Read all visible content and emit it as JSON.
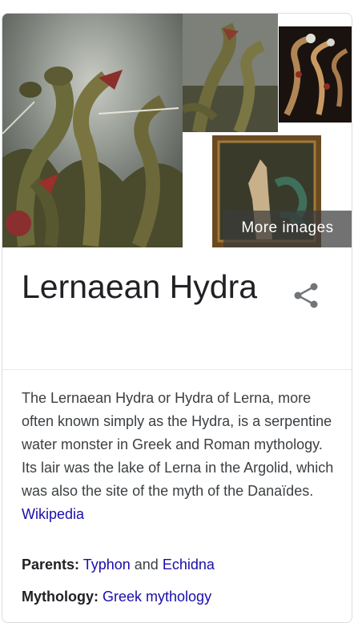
{
  "gallery": {
    "images": [
      {
        "alt": "hydra-painting-main"
      },
      {
        "alt": "hydra-sculpture"
      },
      {
        "alt": "hydra-vase-painting"
      },
      {
        "alt": "heracles-and-hydra-painting"
      }
    ],
    "more_images_label": "More images"
  },
  "entity": {
    "title": "Lernaean Hydra",
    "share_icon": "share-icon"
  },
  "description": {
    "text": "The Lernaean Hydra or Hydra of Lerna, more often known simply as the Hydra, is a serpentine water monster in Greek and Roman mythology. Its lair was the lake of Lerna in the Argolid, which was also the site of the myth of the Danaïdes.",
    "source_link": "Wikipedia"
  },
  "facts": {
    "parents": {
      "label": "Parents:",
      "value1": "Typhon",
      "conjunction": "and",
      "value2": "Echidna"
    },
    "mythology": {
      "label": "Mythology:",
      "value": "Greek mythology"
    }
  },
  "colors": {
    "link": "#1a0dab",
    "text": "#3c4043",
    "border": "#dadce0"
  }
}
